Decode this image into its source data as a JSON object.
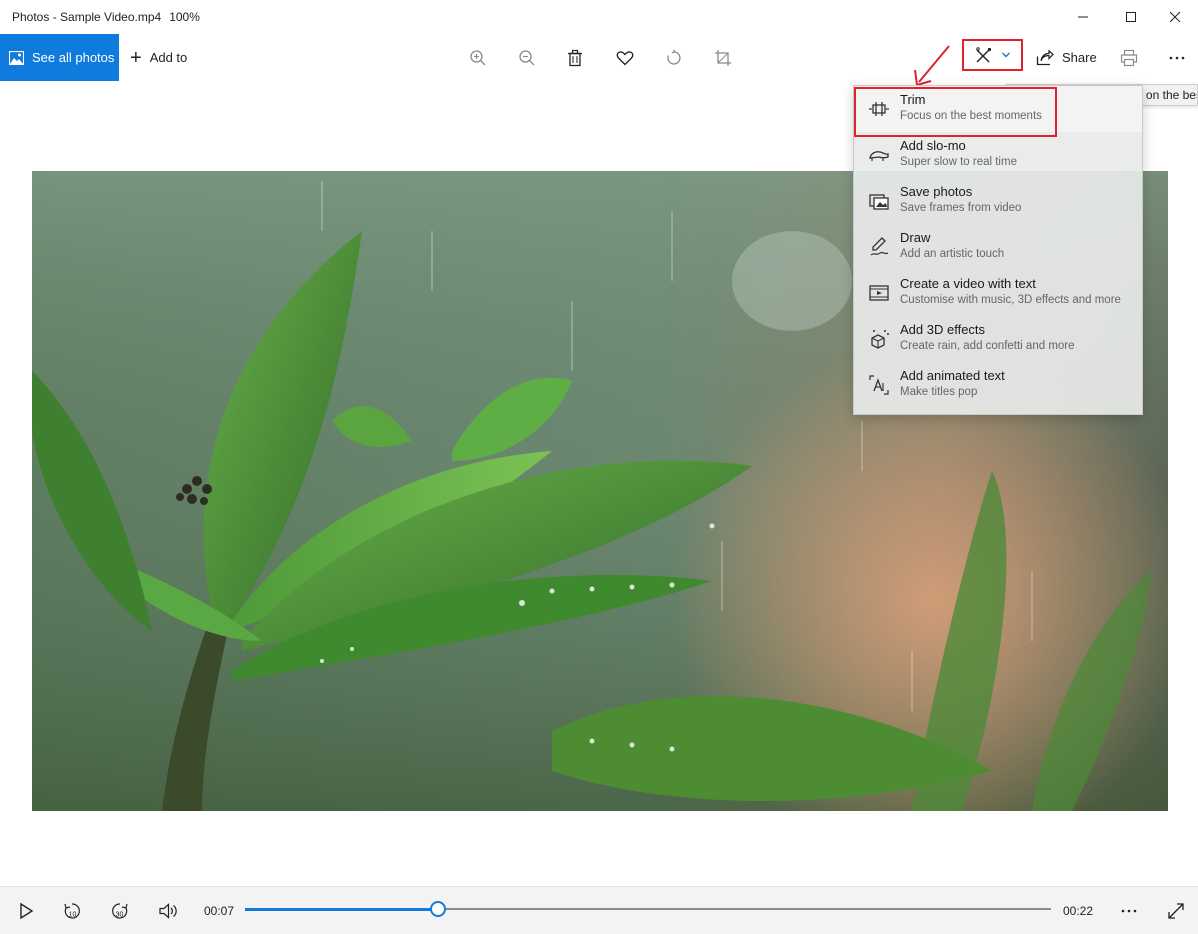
{
  "window": {
    "title": "Photos - Sample Video.mp4",
    "zoom": "100%"
  },
  "toolbar": {
    "see_all_label": "See all photos",
    "add_to_label": "Add to",
    "share_label": "Share"
  },
  "tooltip": {
    "text": "Trim your video to focus on the best moments"
  },
  "menu": {
    "items": [
      {
        "title": "Trim",
        "subtitle": "Focus on the best moments",
        "icon": "trim-icon"
      },
      {
        "title": "Add slo-mo",
        "subtitle": "Super slow to real time",
        "icon": "slo-mo-icon"
      },
      {
        "title": "Save photos",
        "subtitle": "Save frames from video",
        "icon": "save-photos-icon"
      },
      {
        "title": "Draw",
        "subtitle": "Add an artistic touch",
        "icon": "draw-icon"
      },
      {
        "title": "Create a video with text",
        "subtitle": "Customise with music, 3D effects and more",
        "icon": "video-text-icon"
      },
      {
        "title": "Add 3D effects",
        "subtitle": "Create rain, add confetti and more",
        "icon": "3d-effects-icon"
      },
      {
        "title": "Add animated text",
        "subtitle": "Make titles pop",
        "icon": "animated-text-icon"
      }
    ]
  },
  "playback": {
    "current_time": "00:07",
    "total_time": "00:22",
    "progress": 0.24,
    "rewind_label": "10",
    "forward_label": "30"
  },
  "colors": {
    "accent": "#0f7bdc",
    "annotation": "#e0222e"
  }
}
